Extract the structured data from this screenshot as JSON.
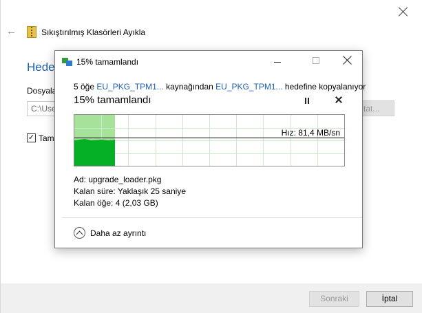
{
  "wizard": {
    "title": "Sıkıştırılmış Klasörleri Ayıkla",
    "heading": "Hedef",
    "folder_label": "Dosyala",
    "path_value": "C:\\Use",
    "browse_label": "tat...",
    "checkbox_label": "Tama",
    "checkbox_mark": "✓",
    "back_glyph": "←",
    "next_label": "Sonraki",
    "cancel_label": "İptal"
  },
  "dialog": {
    "title": "15%  tamamlandı",
    "desc_prefix": "5 öğe",
    "source_link": "EU_PKG_TPM1...",
    "desc_middle": "kaynağından",
    "dest_link": "EU_PKG_TPM1...",
    "desc_suffix": "hedefine kopyalanıyor",
    "percent_text": "15%  tamamlandı",
    "progress_fraction": 0.15,
    "speed_label": "Hız: 81,4 MB/sn",
    "name_label": "Ad:",
    "name_value": "upgrade_loader.pkg",
    "time_label": "Kalan süre:",
    "time_value": "Yaklaşık 25 saniye",
    "items_label": "Kalan öğe:",
    "items_value": "4 (2,03 GB)",
    "less_details": "Daha az ayrıntı"
  },
  "icons": [
    "back-arrow-icon",
    "zip-folder-icon",
    "close-icon",
    "copy-icon",
    "minimize-icon",
    "maximize-icon",
    "pause-icon",
    "stop-icon",
    "chevron-up-icon"
  ],
  "colors": {
    "accent_blue": "#1a5fb4",
    "heading_blue": "#1e5fa8",
    "progress_green": "#06b025",
    "progress_light_green": "#a6e29a",
    "grid_green": "#cde8cd"
  }
}
